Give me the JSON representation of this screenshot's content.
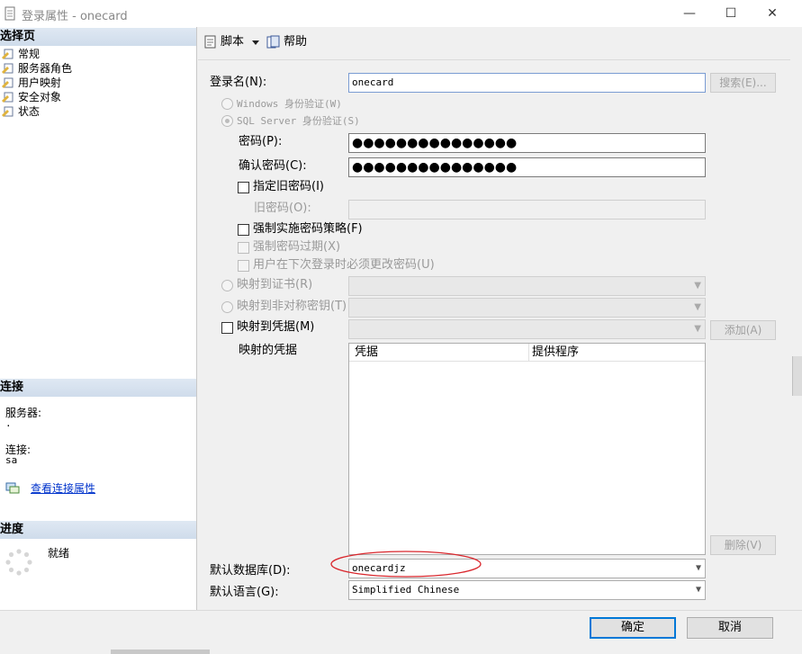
{
  "window": {
    "title": "登录属性 - onecard",
    "minimize": "—",
    "maximize": "☐",
    "close": "✕"
  },
  "left": {
    "select_page_header": "选择页",
    "pages": [
      "常规",
      "服务器角色",
      "用户映射",
      "安全对象",
      "状态"
    ],
    "connection_header": "连接",
    "server_label": "服务器:",
    "server_value": ".",
    "connection_label": "连接:",
    "connection_value": "sa",
    "view_props_link": "查看连接属性",
    "progress_header": "进度",
    "progress_status": "就绪"
  },
  "toolbar": {
    "script_label": "脚本",
    "help_label": "帮助"
  },
  "form": {
    "login_name_label": "登录名(N):",
    "login_name_value": "onecard",
    "search_button": "搜索(E)...",
    "windows_auth_label": "Windows 身份验证(W)",
    "sql_auth_label": "SQL Server 身份验证(S)",
    "password_label": "密码(P):",
    "password_value": "●●●●●●●●●●●●●●●",
    "confirm_password_label": "确认密码(C):",
    "confirm_password_value": "●●●●●●●●●●●●●●●",
    "specify_old_password_label": "指定旧密码(I)",
    "old_password_label": "旧密码(O):",
    "enforce_policy_label": "强制实施密码策略(F)",
    "enforce_expiration_label": "强制密码过期(X)",
    "must_change_label": "用户在下次登录时必须更改密码(U)",
    "map_certificate_label": "映射到证书(R)",
    "map_asym_key_label": "映射到非对称密钥(T)",
    "map_credential_label": "映射到凭据(M)",
    "add_button": "添加(A)",
    "mapped_credentials_label": "映射的凭据",
    "grid_columns": [
      "凭据",
      "提供程序"
    ],
    "remove_button": "删除(V)",
    "default_db_label": "默认数据库(D):",
    "default_db_value": "onecardjz",
    "default_lang_label": "默认语言(G):",
    "default_lang_value": "Simplified Chinese"
  },
  "dialog": {
    "ok_button": "确定",
    "cancel_button": "取消"
  },
  "colors": {
    "header_band": "#d5e1ee",
    "link": "#0033cc",
    "annotation_ellipse": "#d9262c",
    "primary_border": "#0078d7"
  }
}
